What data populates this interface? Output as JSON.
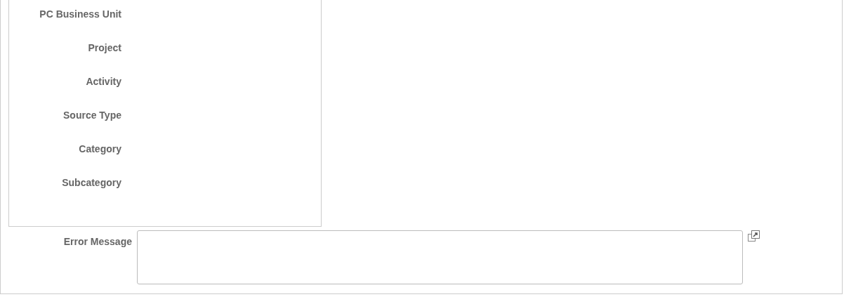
{
  "fields": [
    {
      "label": "PC Business Unit"
    },
    {
      "label": "Project"
    },
    {
      "label": "Activity"
    },
    {
      "label": "Source Type"
    },
    {
      "label": "Category"
    },
    {
      "label": "Subcategory"
    }
  ],
  "error_message": {
    "label": "Error Message"
  }
}
